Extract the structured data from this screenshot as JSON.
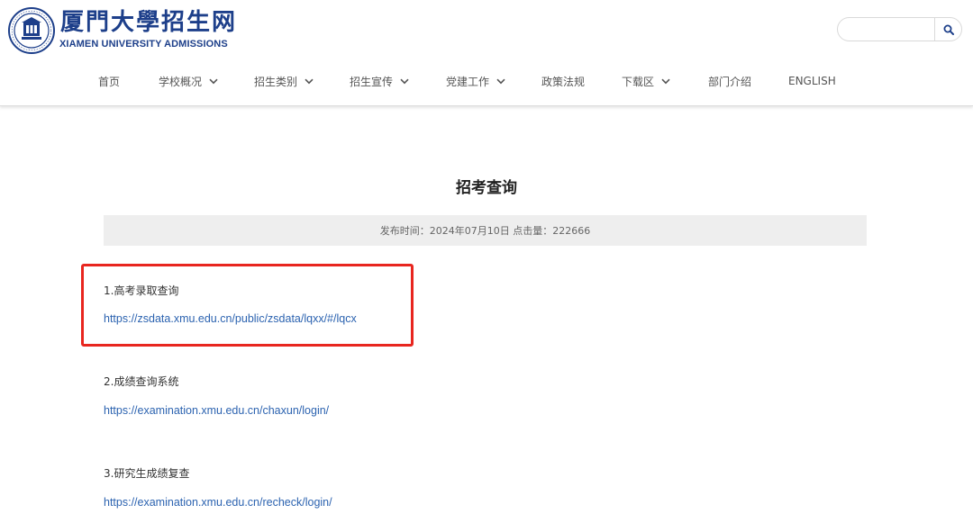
{
  "header": {
    "logo_cn": "厦門大學招生网",
    "logo_en": "XIAMEN UNIVERSITY ADMISSIONS",
    "logo_seal_icon": "university-seal-icon",
    "brand_color": "#1d3f8a",
    "search": {
      "value": "",
      "placeholder": "",
      "button_icon": "search-icon"
    }
  },
  "nav": {
    "items": [
      {
        "label": "首页",
        "has_dropdown": false
      },
      {
        "label": "学校概况",
        "has_dropdown": true
      },
      {
        "label": "招生类别",
        "has_dropdown": true
      },
      {
        "label": "招生宣传",
        "has_dropdown": true
      },
      {
        "label": "党建工作",
        "has_dropdown": true
      },
      {
        "label": "政策法规",
        "has_dropdown": false
      },
      {
        "label": "下载区",
        "has_dropdown": true
      },
      {
        "label": "部门介绍",
        "has_dropdown": false
      },
      {
        "label": "ENGLISH",
        "has_dropdown": false
      }
    ]
  },
  "article": {
    "title": "招考查询",
    "publish_label": "发布时间：",
    "publish_date": "2024年07月10日",
    "clicks_label": "点击量：",
    "clicks": "222666",
    "highlight_color": "#e8261f",
    "link_color": "#2c63b0",
    "entries": [
      {
        "label": "1.高考录取查询",
        "url": "https://zsdata.xmu.edu.cn/public/zsdata/lqxx/#/lqcx"
      },
      {
        "label": "2.成绩查询系统",
        "url": "https://examination.xmu.edu.cn/chaxun/login/"
      },
      {
        "label": "3.研究生成绩复查",
        "url": "https://examination.xmu.edu.cn/recheck/login/"
      }
    ]
  }
}
